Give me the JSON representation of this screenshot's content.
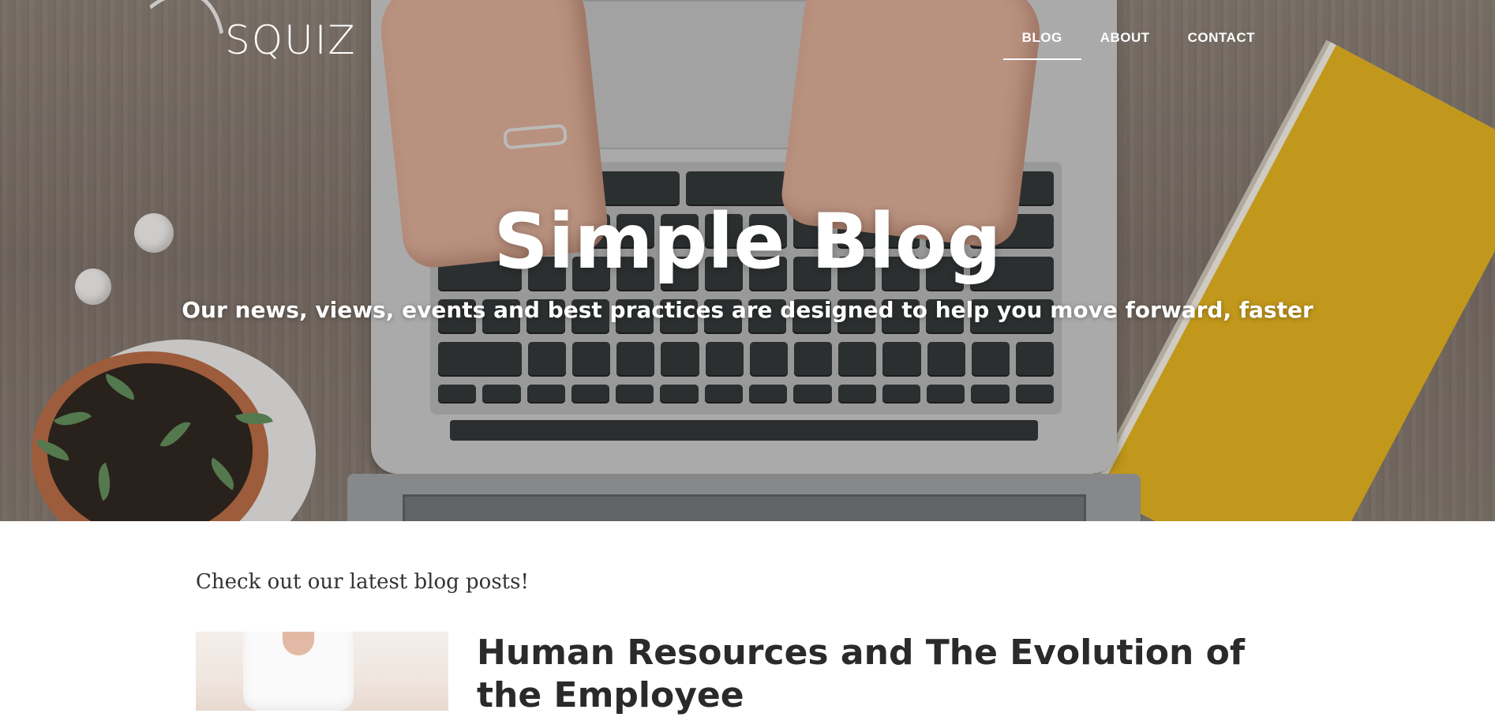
{
  "brand": {
    "logo_text": "SQUIZ"
  },
  "nav": {
    "items": [
      {
        "label": "BLOG",
        "active": true
      },
      {
        "label": "ABOUT",
        "active": false
      },
      {
        "label": "CONTACT",
        "active": false
      }
    ]
  },
  "hero": {
    "title": "Simple Blog",
    "subtitle": "Our news, views, events and best practices are designed to help you move forward, faster"
  },
  "content": {
    "intro": "Check out our latest blog posts!",
    "posts": [
      {
        "title": "Human Resources and The Evolution of the Employee"
      }
    ]
  },
  "colors": {
    "hero_text": "#ffffff",
    "body_text": "#2a2a2a",
    "background": "#ffffff"
  }
}
